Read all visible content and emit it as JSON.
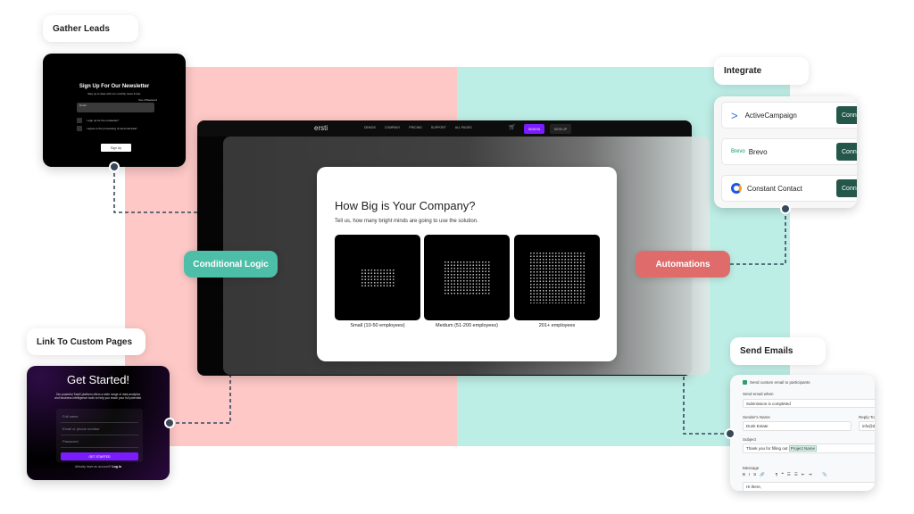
{
  "colors": {
    "pink": "#fdc8c6",
    "teal": "#bdeee6",
    "conditional": "#4dbfa8",
    "automations": "#e06b6b",
    "accent": "#7b1cff",
    "connect": "#24574a"
  },
  "labels": {
    "gather_leads": "Gather Leads",
    "integrate": "Integrate",
    "link_pages": "Link To Custom Pages",
    "send_emails": "Send Emails",
    "conditional_logic": "Conditional Logic",
    "automations": "Automations"
  },
  "newsletter": {
    "title": "Sign Up For Our Newsletter",
    "subtitle": "Stay up to date with our monthly news & tips.",
    "email_label": "Email",
    "tooltip": "Use 1Password",
    "check1": "I sign up for the newsletter*",
    "check2": "I agree to the processing of personal data*",
    "button": "Sign Up"
  },
  "site": {
    "logo": "ersti",
    "nav": [
      "DEMOS",
      "COMPANY",
      "PRICING",
      "SUPPORT",
      "ALL PAGES"
    ],
    "sign_in": "SIGN IN",
    "sign_up": "SIGN UP"
  },
  "quiz": {
    "title": "How Big is Your Company?",
    "subtitle": "Tell us, how many bright minds are going to use the solution.",
    "options": [
      "Small (10-50 employees)",
      "Medium (51-200 employees)",
      "201+ employees"
    ]
  },
  "integrations": [
    {
      "name": "ActiveCampaign",
      "button": "Connect"
    },
    {
      "name": "Brevo",
      "logo": "Brevo",
      "button": "Connect"
    },
    {
      "name": "Constant Contact",
      "button": "Connect"
    }
  ],
  "get_started": {
    "title": "Get Started!",
    "subtitle": "Our powerful SaaS platform offers a wide range of data analytics and business intelligence tools to help you reach your full potential.",
    "fields": [
      "Full name",
      "Email or phone number",
      "Password"
    ],
    "button": "GET STARTED",
    "footer": "Already have an account?",
    "login": "Log in"
  },
  "email": {
    "checkbox": "Send custom email to participants",
    "when_label": "Send email when",
    "when_value": "Submission is completed",
    "sender_label": "Sender's Name",
    "sender_value": "Dunk Estate",
    "reply_label": "Reply-To",
    "reply_value": "info@d",
    "subject_label": "Subject",
    "subject_value": "Thank you for filling out",
    "subject_tag": "Project Name",
    "message_label": "Message",
    "toolbar": [
      "B",
      "I",
      "S",
      "🔗",
      "¶",
      "❝",
      "☰",
      "☰",
      "⇤",
      "⇥",
      "📎"
    ],
    "message_value": "Hi there,"
  }
}
